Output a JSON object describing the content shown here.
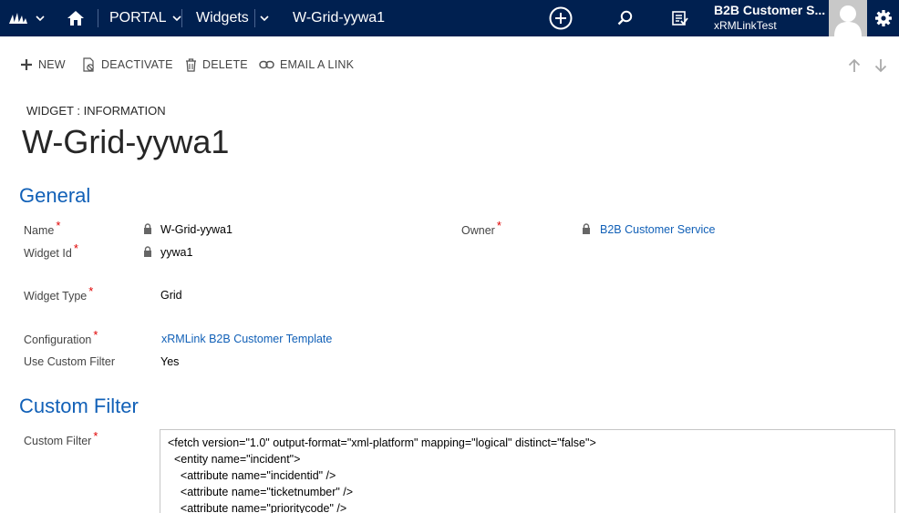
{
  "nav": {
    "module": "PORTAL",
    "area": "Widgets",
    "record": "W-Grid-yywa1",
    "user_name": "B2B Customer S...",
    "user_org": "xRMLinkTest"
  },
  "commands": {
    "new": "NEW",
    "deactivate": "DEACTIVATE",
    "delete": "DELETE",
    "email_link": "EMAIL A LINK"
  },
  "header": {
    "entity_label": "WIDGET : INFORMATION",
    "title": "W-Grid-yywa1"
  },
  "sections": {
    "general": "General",
    "custom_filter": "Custom Filter"
  },
  "fields": {
    "name_label": "Name",
    "name_value": "W-Grid-yywa1",
    "widget_id_label": "Widget Id",
    "widget_id_value": "yywa1",
    "owner_label": "Owner",
    "owner_value": "B2B Customer Service",
    "widget_type_label": "Widget Type",
    "widget_type_value": "Grid",
    "configuration_label": "Configuration",
    "configuration_value": "xRMLink B2B Customer Template",
    "use_custom_filter_label": "Use Custom Filter",
    "use_custom_filter_value": "Yes",
    "custom_filter_label": "Custom Filter",
    "required_marker": "*"
  },
  "custom_filter_code": [
    "<fetch version=\"1.0\" output-format=\"xml-platform\" mapping=\"logical\" distinct=\"false\">",
    "  <entity name=\"incident\">",
    "    <attribute name=\"incidentid\" />",
    "    <attribute name=\"ticketnumber\" />",
    "    <attribute name=\"prioritycode\" />"
  ],
  "colors": {
    "nav_bg": "#002050",
    "link": "#1160b7",
    "required": "#e00000"
  },
  "icons": {
    "logo": "dynamics-logo-icon",
    "home": "home-icon",
    "create": "plus-circle-icon",
    "search": "search-icon",
    "activities": "task-list-icon",
    "settings": "gear-icon"
  }
}
